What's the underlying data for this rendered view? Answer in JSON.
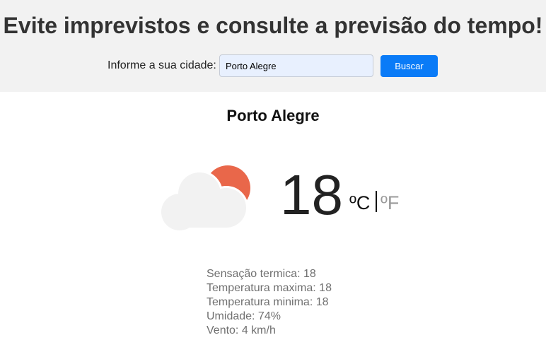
{
  "header": {
    "title": "Evite imprevistos e consulte a previsão do tempo!",
    "search_label": "Informe a sua cidade:",
    "search_value": "Porto Alegre",
    "button_label": "Buscar"
  },
  "weather": {
    "city": "Porto Alegre",
    "icon": "partly-cloudy-icon",
    "temperature": "18",
    "unit_celsius": "ºC",
    "unit_fahrenheit": "ºF",
    "details": [
      "Sensação termica: 18",
      "Temperatura maxima: 18",
      "Temperatura minima: 18",
      "Umidade: 74%",
      "Vento: 4 km/h"
    ]
  },
  "colors": {
    "header_bg": "#f2f2f2",
    "button_bg": "#0a7bf7",
    "input_bg": "#e8f0fe",
    "sun": "#e9674a",
    "cloud": "#f2f2f2"
  }
}
